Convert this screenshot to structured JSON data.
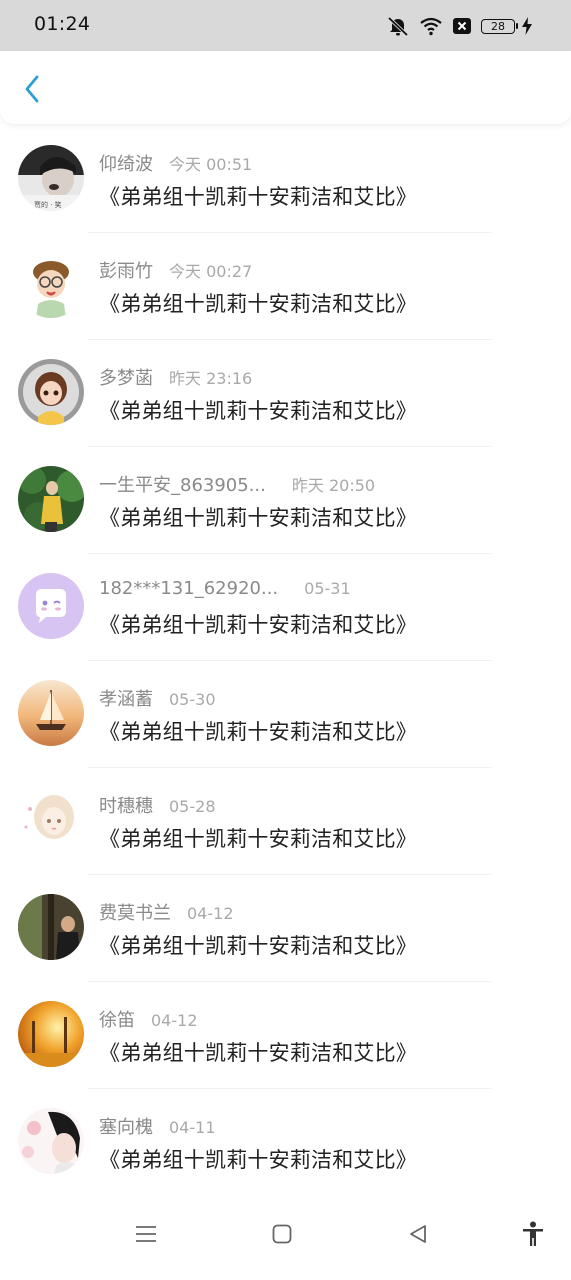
{
  "status_bar": {
    "time": "01:24",
    "battery_level": "28",
    "icons": [
      "mute-icon",
      "wifi-icon",
      "sim-off-icon",
      "battery-icon",
      "charging-icon"
    ]
  },
  "header": {
    "back_icon": "chevron-left-icon",
    "accent_color": "#2a9fd6"
  },
  "messages": [
    {
      "name": "仰绮波",
      "time": "今天 00:51",
      "text": "《弟弟组十凯莉十安莉洁和艾比》"
    },
    {
      "name": "彭雨竹",
      "time": "今天 00:27",
      "text": "《弟弟组十凯莉十安莉洁和艾比》"
    },
    {
      "name": "多梦菡",
      "time": "昨天 23:16",
      "text": "《弟弟组十凯莉十安莉洁和艾比》"
    },
    {
      "name": "一生平安_863905...",
      "time": "昨天 20:50",
      "text": "《弟弟组十凯莉十安莉洁和艾比》"
    },
    {
      "name": "182***131_62920...",
      "time": "05-31",
      "text": "《弟弟组十凯莉十安莉洁和艾比》"
    },
    {
      "name": "孝涵蓄",
      "time": "05-30",
      "text": "《弟弟组十凯莉十安莉洁和艾比》"
    },
    {
      "name": "时穗穗",
      "time": "05-28",
      "text": "《弟弟组十凯莉十安莉洁和艾比》"
    },
    {
      "name": "费莫书兰",
      "time": "04-12",
      "text": "《弟弟组十凯莉十安莉洁和艾比》"
    },
    {
      "name": "徐笛",
      "time": "04-12",
      "text": "《弟弟组十凯莉十安莉洁和艾比》"
    },
    {
      "name": "塞向槐",
      "time": "04-11",
      "text": "《弟弟组十凯莉十安莉洁和艾比》"
    }
  ],
  "nav_bar": {
    "icons": [
      "menu-icon",
      "home-square-icon",
      "back-triangle-icon",
      "accessibility-icon"
    ]
  }
}
